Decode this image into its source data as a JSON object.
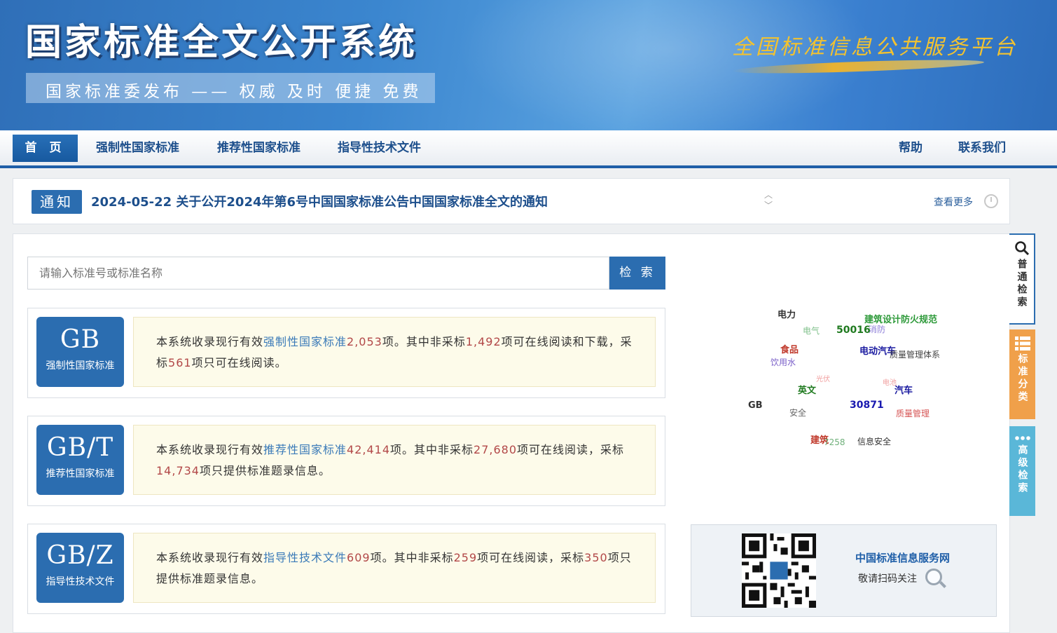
{
  "header": {
    "title": "国家标准全文公开系统",
    "slogan": "国家标准委发布 —— 权威 及时 便捷 免费",
    "platform": "全国标准信息公共服务平台"
  },
  "nav": {
    "home": "首 页",
    "items": [
      "强制性国家标准",
      "推荐性国家标准",
      "指导性技术文件"
    ],
    "help": "帮助",
    "contact": "联系我们"
  },
  "notice": {
    "tag": "通知",
    "text": "2024-05-22  关于公开2024年第6号中国国家标准公告中国国家标准全文的通知",
    "more": "查看更多"
  },
  "search": {
    "placeholder": "请输入标准号或标准名称",
    "button": "检 索"
  },
  "cards": [
    {
      "code": "GB",
      "sub": "强制性国家标准",
      "t1": "本系统收录现行有效",
      "link": "强制性国家标准",
      "n1": "2,053",
      "t2": "项。其中非采标",
      "n2": "1,492",
      "t3": "项可在线阅读和下载，采标",
      "n3": "561",
      "t4": "项只可在线阅读。"
    },
    {
      "code": "GB/T",
      "sub": "推荐性国家标准",
      "t1": "本系统收录现行有效",
      "link": "推荐性国家标准",
      "n1": "42,414",
      "t2": "项。其中非采标",
      "n2": "27,680",
      "t3": "项可在线阅读，采标",
      "n3": "14,734",
      "t4": "项只提供标准题录信息。"
    },
    {
      "code": "GB/Z",
      "sub": "指导性技术文件",
      "t1": "本系统收录现行有效",
      "link": "指导性技术文件",
      "n1": "609",
      "t2": "项。其中非采标",
      "n2": "259",
      "t3": "项可在线阅读，采标",
      "n3": "350",
      "t4": "项只提供标准题录信息。"
    }
  ],
  "cloud": [
    {
      "text": "电力",
      "color": "#333333"
    },
    {
      "text": "建筑设计防火规范",
      "color": "#2e9a3a"
    },
    {
      "text": "电气",
      "color": "#7fc08a"
    },
    {
      "text": "50016",
      "color": "#1f7a1f"
    },
    {
      "text": "消防",
      "color": "#8e7fd8"
    },
    {
      "text": "食品",
      "color": "#c0392b"
    },
    {
      "text": "电动汽车",
      "color": "#1a1aa0"
    },
    {
      "text": "质量管理体系",
      "color": "#444444"
    },
    {
      "text": "饮用水",
      "color": "#7a5fc8"
    },
    {
      "text": "光伏",
      "color": "#f1a0a0"
    },
    {
      "text": "电池",
      "color": "#f1a0a0"
    },
    {
      "text": "英文",
      "color": "#1f7a1f"
    },
    {
      "text": "汽车",
      "color": "#1a1aa0"
    },
    {
      "text": "GB",
      "color": "#333333"
    },
    {
      "text": "安全",
      "color": "#666666"
    },
    {
      "text": "30871",
      "color": "#1a1ab0"
    },
    {
      "text": "质量管理",
      "color": "#d65555"
    },
    {
      "text": "建筑",
      "color": "#c0392b"
    },
    {
      "text": "7258",
      "color": "#6fb07a"
    },
    {
      "text": "信息安全",
      "color": "#333333"
    }
  ],
  "qr": {
    "title": "中国标准信息服务网",
    "sub": "敬请扫码关注"
  },
  "side": {
    "t1": "普通检索",
    "t2": "标准分类",
    "t3": "高级检索"
  }
}
